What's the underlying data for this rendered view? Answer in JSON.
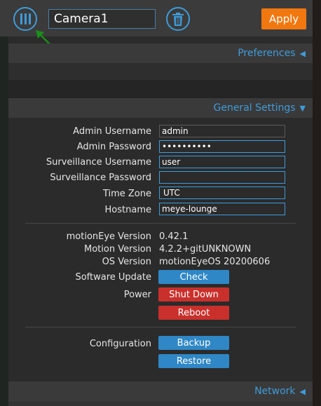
{
  "header": {
    "camera_name": "Camera1",
    "apply_label": "Apply",
    "accent_color": "#3f9bd9",
    "apply_color": "#f0780f"
  },
  "sections": {
    "preferences": "Preferences",
    "general_settings": "General Settings",
    "network": "Network"
  },
  "general": {
    "admin_username": {
      "label": "Admin Username",
      "value": "admin"
    },
    "admin_password": {
      "label": "Admin Password",
      "value": "••••••••••"
    },
    "surveillance_username": {
      "label": "Surveillance Username",
      "value": "user"
    },
    "surveillance_password": {
      "label": "Surveillance Password",
      "value": ""
    },
    "time_zone": {
      "label": "Time Zone",
      "value": "UTC"
    },
    "hostname": {
      "label": "Hostname",
      "value": "meye-lounge"
    }
  },
  "versions": {
    "motioneye": {
      "label": "motionEye Version",
      "value": "0.42.1"
    },
    "motion": {
      "label": "Motion Version",
      "value": "4.2.2+gitUNKNOWN"
    },
    "os": {
      "label": "OS Version",
      "value": "motionEyeOS 20200606"
    }
  },
  "actions": {
    "software_update_label": "Software Update",
    "check_label": "Check",
    "power_label": "Power",
    "shutdown_label": "Shut Down",
    "reboot_label": "Reboot",
    "configuration_label": "Configuration",
    "backup_label": "Backup",
    "restore_label": "Restore"
  }
}
